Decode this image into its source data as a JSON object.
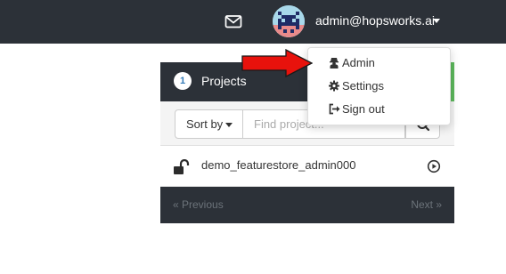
{
  "header": {
    "user_email": "admin@hopsworks.ai",
    "icons": {
      "mail": "envelope-icon",
      "avatar": "pixel-invader-avatar",
      "caret": "caret-down-icon"
    }
  },
  "user_menu": {
    "items": [
      {
        "label": "Admin",
        "icon": "user-secret-icon"
      },
      {
        "label": "Settings",
        "icon": "cog-icon"
      },
      {
        "label": "Sign out",
        "icon": "sign-out-icon"
      }
    ]
  },
  "projects_panel": {
    "count": "1",
    "title": "Projects",
    "sort_label": "Sort by",
    "search_placeholder": "Find project...",
    "projects": [
      {
        "name": "demo_featurestore_admin000",
        "lock_icon": "unlock-icon",
        "action_icon": "play-circle-icon"
      }
    ],
    "pagination": {
      "previous": "« Previous",
      "next": "Next »"
    }
  },
  "annotation": {
    "arrow_color": "#e8120c"
  },
  "colors": {
    "topbar": "#2c3138",
    "accent_green": "#5cb85c",
    "badge_text": "#337ab7"
  }
}
